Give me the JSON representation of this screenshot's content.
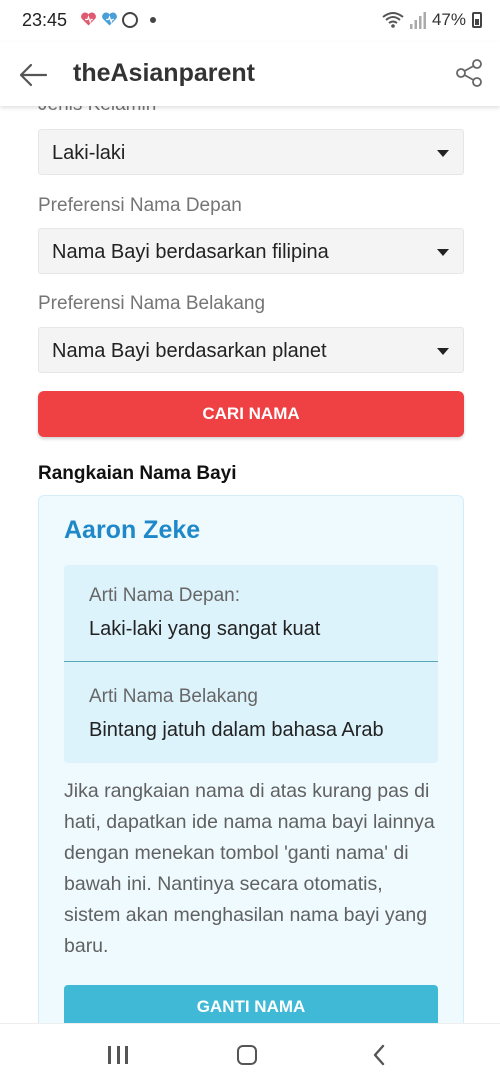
{
  "status_bar": {
    "time": "23:45",
    "battery": "47%",
    "icons": [
      "heart-icon",
      "heart-icon",
      "whatsapp-icon",
      "dot-icon",
      "wifi-icon",
      "signal-icon",
      "battery-icon"
    ]
  },
  "appbar": {
    "title": "theAsianparent",
    "icons": [
      "arrow-left-icon",
      "share-icon"
    ]
  },
  "form": {
    "gender_label": "Jenis Kelamin",
    "gender_value": "Laki-laki",
    "first_name_label": "Preferensi Nama Depan",
    "first_name_value": "Nama Bayi berdasarkan filipina",
    "last_name_label": "Preferensi Nama Belakang",
    "last_name_value": "Nama Bayi berdasarkan planet",
    "search_button": "CARI NAMA"
  },
  "result": {
    "section_title": "Rangkaian Nama Bayi",
    "name": "Aaron Zeke",
    "first_meaning_label": "Arti Nama Depan:",
    "first_meaning_value": "Laki-laki yang sangat kuat",
    "last_meaning_label": "Arti Nama Belakang",
    "last_meaning_value": "Bintang jatuh dalam bahasa Arab",
    "hint_text": "Jika rangkaian nama di atas kurang pas di hati, dapatkan ide nama nama bayi lainnya dengan menekan tombol 'ganti nama' di bawah ini. Nantinya secara otomatis, sistem akan menghasilan nama bayi yang baru.",
    "change_button": "GANTI NAMA"
  },
  "colors": {
    "primary_red": "#ef4143",
    "teal_button": "#3fb9d6",
    "name_blue": "#1e88c8",
    "card_bg": "#eefafe",
    "meaning_bg": "#ddf3fc"
  }
}
